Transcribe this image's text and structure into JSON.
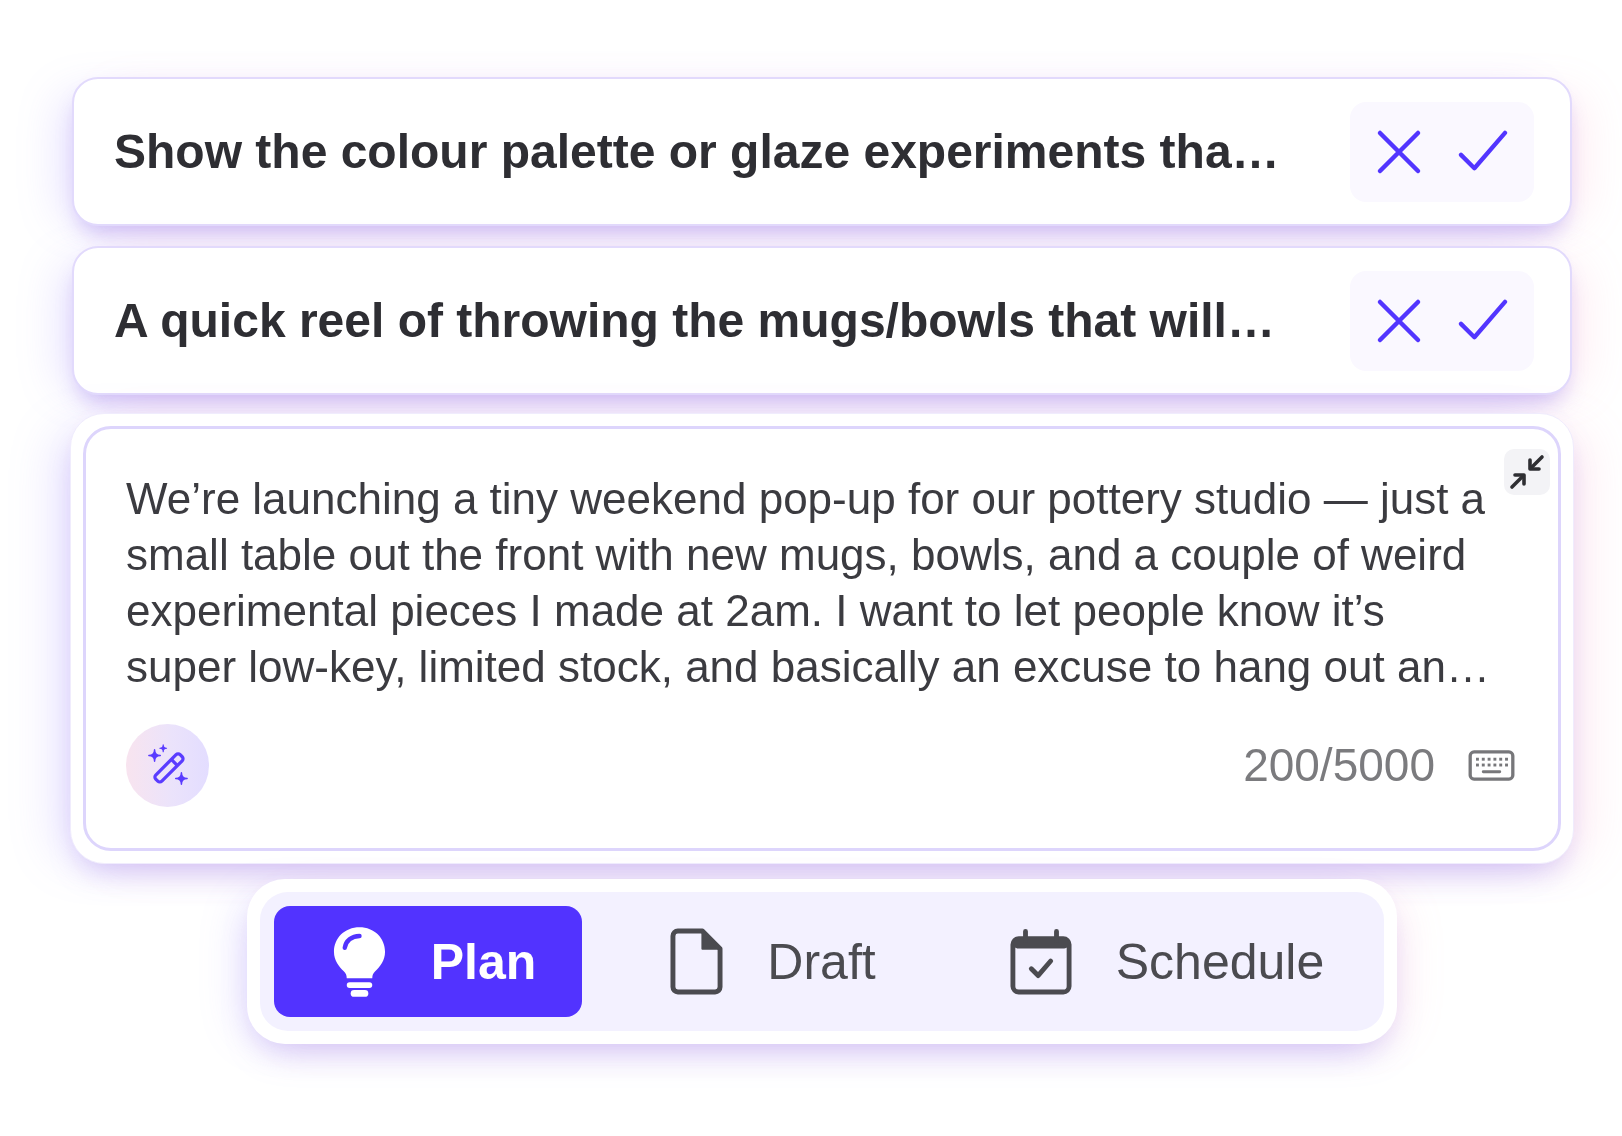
{
  "suggestions": [
    {
      "text": "Show the colour palette or glaze experiments tha…"
    },
    {
      "text": "A quick reel of throwing the mugs/bowls that will…"
    }
  ],
  "composer": {
    "value": "We’re launching a tiny weekend pop-up for our pottery studio — just a small table out the front with new mugs, bowls, and a couple of weird experimental pieces I made at 2am. I want to let people know it’s super low-key, limited stock, and basically an excuse to hang out an…",
    "counter": "200/5000"
  },
  "modes": [
    {
      "label": "Plan",
      "selected": true
    },
    {
      "label": "Draft",
      "selected": false
    },
    {
      "label": "Schedule",
      "selected": false
    }
  ]
}
